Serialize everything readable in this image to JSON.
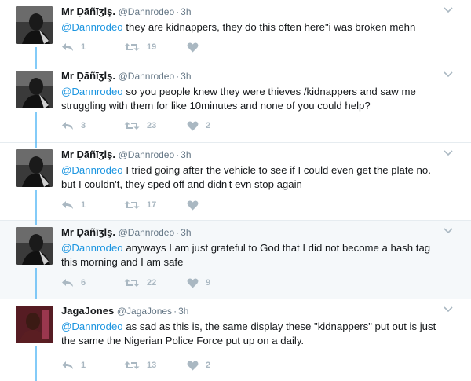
{
  "tweets": [
    {
      "fullname": "Mr Ḍāñīʒlş.",
      "username": "@Dannrodeo",
      "time": "3h",
      "mention": "@Dannrodeo",
      "text": " they are kidnappers, they do this often here\"i was broken mehn",
      "replies": "1",
      "retweets": "19",
      "likes": "",
      "avatar": "dark-portrait"
    },
    {
      "fullname": "Mr Ḍāñīʒlş.",
      "username": "@Dannrodeo",
      "time": "3h",
      "mention": "@Dannrodeo",
      "text": " so you people knew they were thieves /kidnappers and saw me struggling with them for like 10minutes and none of you could help?",
      "replies": "3",
      "retweets": "23",
      "likes": "2",
      "avatar": "dark-portrait"
    },
    {
      "fullname": "Mr Ḍāñīʒlş.",
      "username": "@Dannrodeo",
      "time": "3h",
      "mention": "@Dannrodeo",
      "text": " I tried going after the vehicle to see if I could even get the plate no. but I couldn't, they sped off and didn't evn stop again",
      "replies": "1",
      "retweets": "17",
      "likes": "",
      "avatar": "dark-portrait"
    },
    {
      "fullname": "Mr Ḍāñīʒlş.",
      "username": "@Dannrodeo",
      "time": "3h",
      "mention": "@Dannrodeo",
      "text": " anyways I am just grateful to God that I did not become a hash tag this morning and I am safe",
      "replies": "6",
      "retweets": "22",
      "likes": "9",
      "avatar": "dark-portrait"
    },
    {
      "fullname": "JagaJones",
      "username": "@JagaJones",
      "time": "3h",
      "mention": "@Dannrodeo",
      "text": " as sad as this is, the same display these \"kidnappers\" put out is just the same the Nigerian Police Force put up on a daily.",
      "replies": "1",
      "retweets": "13",
      "likes": "2",
      "avatar": "red-portrait"
    }
  ],
  "colors": {
    "accent": "#1da1f2",
    "mention": "#1b95e0",
    "muted": "#657786",
    "action": "#aab8c2",
    "highlight_bg": "#f5f8fa"
  },
  "icons": {
    "reply": "reply-icon",
    "retweet": "retweet-icon",
    "like": "heart-icon",
    "caret": "chevron-down-icon"
  }
}
